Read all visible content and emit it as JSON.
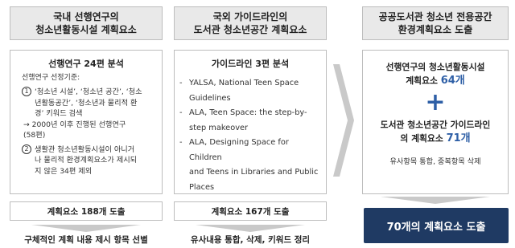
{
  "col1": {
    "header_line1": "국내 선행연구의",
    "header_line2": "청소년활동시설 계획요소",
    "box_title": "선행연구 24편 분석",
    "criteria_label": "선행연구 선정기준:",
    "item1_num": "1",
    "item1_line1": "‘청소년 시설’, ‘청소년 공간’, ‘청소",
    "item1_line2": "년활동공간’, ‘청소년과 물리적 환",
    "item1_line3": "경’ 키워드 검색",
    "arrow_line1": "→ 2000년 이후 진행된 선행연구",
    "arrow_line2": "(58편)",
    "item2_num": "2",
    "item2_line1": "생활관 청소년활동시설이 아니거",
    "item2_line2": "나 물리적 환경계획요소가 제시되",
    "item2_line3": "지 않은 34편 제외",
    "result": "계획요소 188개 도출",
    "tail": "구체적인 계획 내용 제시 항목 선별"
  },
  "col2": {
    "header_line1": "국외 가이드라인의",
    "header_line2": "도서관 청소년공간 계획요소",
    "box_title": "가이드라인 3편 분석",
    "items": [
      {
        "line1": "YALSA, National Teen Space",
        "line2": "Guidelines"
      },
      {
        "line1": "ALA, Teen Space: the step-by-",
        "line2": "step makeover"
      },
      {
        "line1": "ALA, Designing Space for Children",
        "line2": "and Teens in Libraries and Public",
        "line3": "Places"
      }
    ],
    "result": "계획요소 167개 도출",
    "tail": "유사내용 통합, 삭제, 키워드 정리"
  },
  "col3": {
    "header_line1": "공공도서관 청소년 전용공간",
    "header_line2": "환경계획요소 도출",
    "part1_line1": "선행연구의 청소년활동시설",
    "part1_line2_prefix": "계획요소 ",
    "part1_count": "64개",
    "plus": "+",
    "part2_line1": "도서관 청소년공간 가이드라인",
    "part2_line2_prefix": "의 계획요소 ",
    "part2_count": "71개",
    "note": "유사항목 통합, 중복항목 삭제",
    "final": "70개의 계획요소 도출"
  },
  "colors": {
    "accent_blue": "#2e5fa6",
    "final_box": "#1f3a63",
    "header_bg": "#e9e9e9",
    "arrow_gray": "#c9c9c9"
  }
}
